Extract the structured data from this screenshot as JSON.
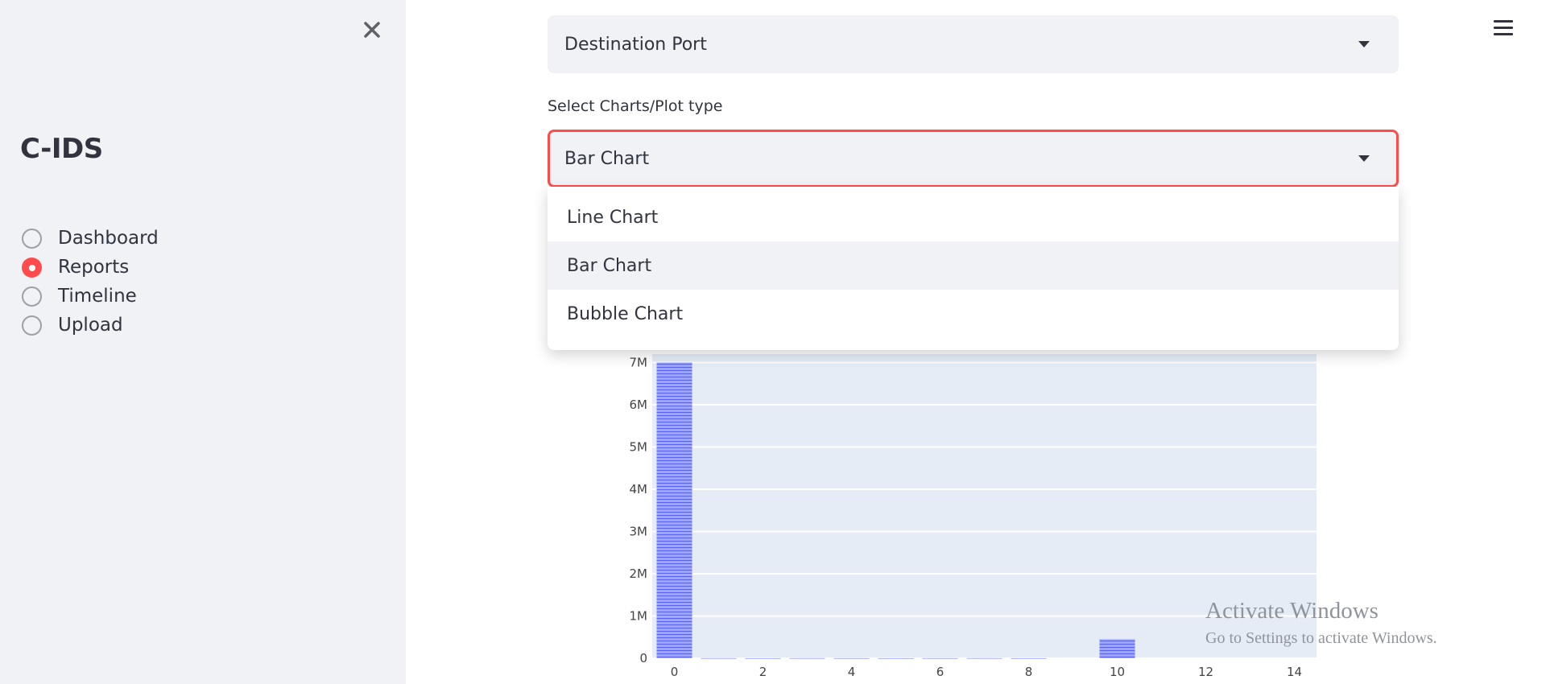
{
  "sidebar": {
    "title": "C-IDS",
    "nav": [
      {
        "label": "Dashboard",
        "selected": false
      },
      {
        "label": "Reports",
        "selected": true
      },
      {
        "label": "Timeline",
        "selected": false
      },
      {
        "label": "Upload",
        "selected": false
      }
    ]
  },
  "main": {
    "port_select": {
      "value": "Destination Port"
    },
    "chart_type_select": {
      "label": "Select Charts/Plot type",
      "value": "Bar Chart",
      "options": [
        "Line Chart",
        "Bar Chart",
        "Bubble Chart"
      ],
      "highlighted": "Bar Chart"
    }
  },
  "colors": {
    "accent": "#ff4b4b",
    "sidebar_bg": "#f0f2f6",
    "bar": "#636efa"
  },
  "chart_data": {
    "type": "bar",
    "title": "",
    "xlabel": "",
    "ylabel": "",
    "x_ticks": [
      "0",
      "2",
      "4",
      "6",
      "8",
      "10",
      "12",
      "14"
    ],
    "y_ticks": [
      "0",
      "1M",
      "2M",
      "3M",
      "4M",
      "5M",
      "6M",
      "7M"
    ],
    "xlim": [
      -0.5,
      14.5
    ],
    "ylim": [
      0,
      7200000
    ],
    "bars": [
      {
        "x": 0,
        "y": 7000000
      },
      {
        "x": 1,
        "y": 4000
      },
      {
        "x": 2,
        "y": 2000
      },
      {
        "x": 3,
        "y": 4000
      },
      {
        "x": 4,
        "y": 3000
      },
      {
        "x": 5,
        "y": 2000
      },
      {
        "x": 6,
        "y": 3000
      },
      {
        "x": 7,
        "y": 4000
      },
      {
        "x": 8,
        "y": 2000
      },
      {
        "x": 10,
        "y": 450000
      }
    ],
    "grid": true
  },
  "watermark": {
    "title": "Activate Windows",
    "subtitle": "Go to Settings to activate Windows."
  }
}
